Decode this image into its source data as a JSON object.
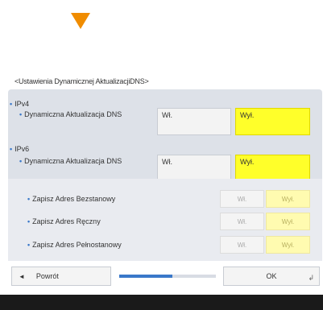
{
  "screen_title": "<Ustawienia Dynamicznej AktualizacjiDNS>",
  "ipv4": {
    "header": "IPv4",
    "row_label": "Dynamiczna Aktualizacja DNS",
    "on_label": "Wł.",
    "off_label": "Wył.",
    "selected": "off"
  },
  "ipv6": {
    "header": "IPv6",
    "row_label": "Dynamiczna Aktualizacja DNS",
    "on_label": "Wł.",
    "off_label": "Wył.",
    "selected": "off",
    "sub_options": [
      {
        "label": "Zapisz Adres Bezstanowy",
        "on_label": "Wł.",
        "off_label": "Wył.",
        "selected": "off"
      },
      {
        "label": "Zapisz Adres Ręczny",
        "on_label": "Wł.",
        "off_label": "Wył.",
        "selected": "off"
      },
      {
        "label": "Zapisz Adres Pełnostanowy",
        "on_label": "Wł.",
        "off_label": "Wył.",
        "selected": "off"
      }
    ]
  },
  "footer": {
    "back_label": "Powrót",
    "ok_label": "OK",
    "progress": 0.55
  },
  "colors": {
    "indicator": "#f08c00",
    "selected": "#ffff2a",
    "accent": "#3a78c9"
  }
}
